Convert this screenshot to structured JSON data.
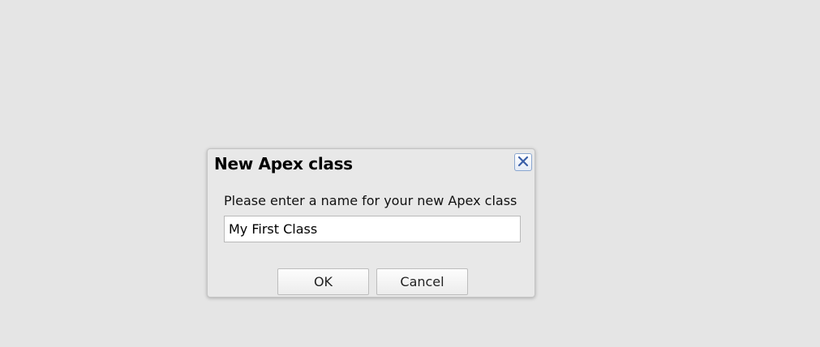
{
  "dialog": {
    "title": "New Apex class",
    "prompt": "Please enter a name for your new Apex class",
    "input_value": "My First Class",
    "ok_label": "OK",
    "cancel_label": "Cancel",
    "close_icon": "close-icon"
  },
  "colors": {
    "background": "#e5e5e5",
    "dialog_background": "#e8e8e8",
    "close_accent": "#3a5fa8"
  }
}
